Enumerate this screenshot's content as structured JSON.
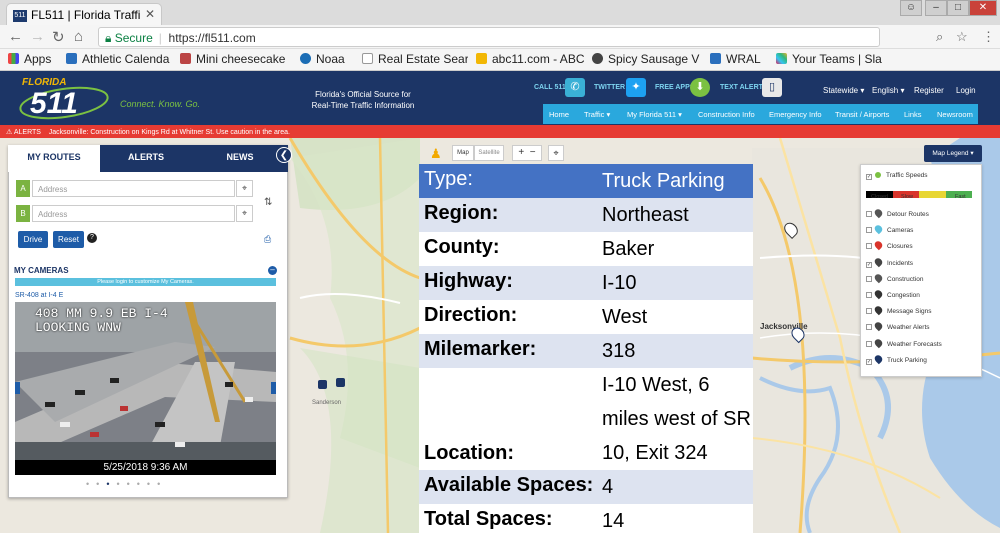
{
  "browser": {
    "tab_title": "FL511 | Florida Traffi",
    "tab_icon": "511",
    "secure_label": "Secure",
    "url": "https://fl511.com",
    "bookmarks": [
      "Apps",
      "Athletic Calenda",
      "Mini cheesecake",
      "Noaa",
      "Real Estate Searc",
      "abc11.com - ABC",
      "Spicy Sausage V",
      "WRAL",
      "Your Teams | Sla"
    ]
  },
  "header": {
    "logo_top": "FLORIDA",
    "logo_number": "511",
    "tagline": "Connect.  Know.  Go.",
    "official_line1": "Florida's Official Source for",
    "official_line2": "Real-Time Traffic Information",
    "call_label": "CALL 511",
    "twitter_label": "TWITTER",
    "apps_label": "FREE APPS",
    "text_label": "TEXT ALERTS",
    "statewide": "Statewide ▾",
    "english": "English ▾",
    "register": "Register",
    "login": "Login",
    "menu": [
      "Home",
      "Traffic ▾",
      "My Florida 511 ▾",
      "Construction Info",
      "Emergency Info",
      "Transit / Airports",
      "Links",
      "Newsroom"
    ]
  },
  "alert": {
    "label": "⚠ ALERTS",
    "text": "Jacksonville: Construction on Kings Rd at Whitner St. Use caution in the area."
  },
  "panel": {
    "tabs": [
      "MY ROUTES",
      "ALERTS",
      "NEWS"
    ],
    "point_a": "A",
    "point_b": "B",
    "address_placeholder": "Address",
    "drive": "Drive",
    "reset": "Reset",
    "my_cameras": "MY CAMERAS",
    "login_notice": "Please login to customize My Cameras.",
    "camera_name": "SR-408 at I-4 E",
    "cam_overlay_line1": "408 MM 9.9 EB I-4",
    "cam_overlay_line2": "LOOKING WNW",
    "cam_date": "5/25/2018 9:36 AM"
  },
  "map": {
    "map_btn": "Map",
    "satellite_btn": "Satellite",
    "zoom_in": "+",
    "zoom_out": "−",
    "legend_btn": "Map Legend ▾",
    "traffic_speeds": "Traffic Speeds",
    "scale_labels": [
      "Closed",
      "Slow",
      "Fast"
    ],
    "legend_items": [
      "Detour Routes",
      "Cameras",
      "Closures",
      "Incidents",
      "Construction",
      "Congestion",
      "Message Signs",
      "Weather Alerts",
      "Weather Forecasts",
      "Truck Parking"
    ],
    "legend_checked": [
      false,
      false,
      false,
      true,
      false,
      false,
      false,
      false,
      false,
      true
    ],
    "legend_colors": [
      "#555",
      "#5bc0de",
      "#d9342b",
      "#444",
      "#555",
      "#333",
      "#333",
      "#444",
      "#444",
      "#1c3566"
    ],
    "scale_colors": [
      "#000000",
      "#d9342b",
      "#e8d633",
      "#4caf50"
    ],
    "place_labels": [
      "Jacksonville",
      "Sanderson"
    ]
  },
  "info": {
    "type_key": "Type:",
    "type_val": "Truck Parking",
    "rows": [
      {
        "k": "Region:",
        "v": "Northeast"
      },
      {
        "k": "County:",
        "v": "Baker"
      },
      {
        "k": "Highway:",
        "v": "I-10"
      },
      {
        "k": "Direction:",
        "v": "West"
      },
      {
        "k": "Milemarker:",
        "v": "318"
      }
    ],
    "location_key": "Location:",
    "location_val": "I-10 West, 6 miles west of SR 10, Exit 324",
    "available_key": "Available Spaces:",
    "available_val": "4",
    "total_key": "Total Spaces:",
    "total_val": "14"
  }
}
